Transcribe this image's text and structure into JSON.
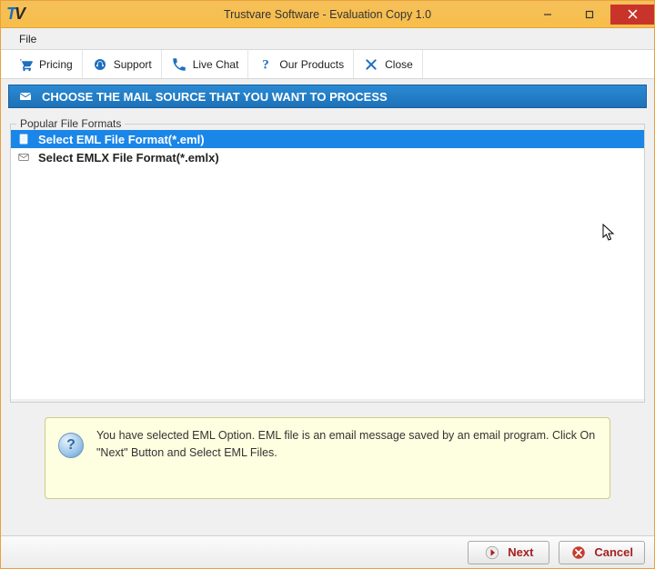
{
  "window": {
    "title": "Trustvare Software - Evaluation Copy 1.0"
  },
  "menubar": {
    "file": "File"
  },
  "toolbar": {
    "pricing": "Pricing",
    "support": "Support",
    "livechat": "Live Chat",
    "ourproducts": "Our Products",
    "close": "Close"
  },
  "banner": {
    "text": "CHOOSE THE MAIL SOURCE THAT YOU WANT TO PROCESS"
  },
  "formats": {
    "legend": "Popular File Formats",
    "items": [
      {
        "label": "Select EML File Format(*.eml)",
        "selected": true
      },
      {
        "label": "Select EMLX File Format(*.emlx)",
        "selected": false
      }
    ]
  },
  "info": {
    "text": "You have selected EML Option. EML file is an email message saved by an email program. Click On \"Next\" Button and Select EML Files."
  },
  "footer": {
    "next": "Next",
    "cancel": "Cancel"
  }
}
